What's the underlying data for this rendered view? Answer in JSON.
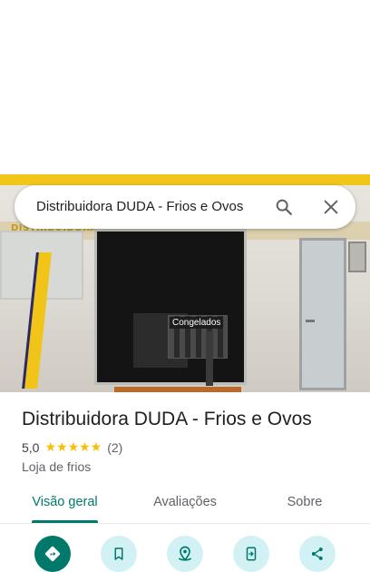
{
  "search": {
    "query": "Distribuidora DUDA - Frios e Ovos"
  },
  "photo": {
    "sign_text": "DISTRIBUIDORA DUDA",
    "freezer_label": "Congelados"
  },
  "place": {
    "title": "Distribuidora DUDA - Frios e Ovos",
    "rating": "5,0",
    "stars": "★★★★★",
    "rating_fraction": 1.0,
    "review_count": "(2)",
    "category": "Loja de frios"
  },
  "tabs": [
    {
      "label": "Visão geral",
      "active": true
    },
    {
      "label": "Avaliações",
      "active": false
    },
    {
      "label": "Sobre",
      "active": false
    }
  ],
  "actions": [
    {
      "icon": "directions-icon"
    },
    {
      "icon": "bookmark-icon"
    },
    {
      "icon": "nearby-icon"
    },
    {
      "icon": "send-to-phone-icon"
    },
    {
      "icon": "share-icon"
    }
  ],
  "colors": {
    "accent": "#00796b",
    "action_bg": "#d2f1f5",
    "star": "#fbbc04"
  }
}
